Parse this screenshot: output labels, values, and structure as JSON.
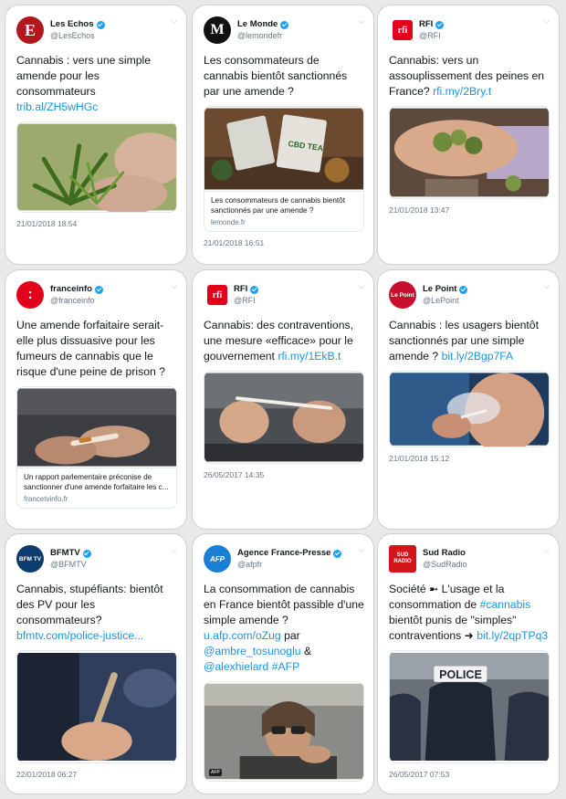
{
  "tweets": [
    {
      "name": "Les Echos",
      "handle": "@LesEchos",
      "avatar_text": "E",
      "avatar_color": "#b3171e",
      "text": "Cannabis : vers une simple amende pour les consommateurs ",
      "link": "trib.al/ZH5wHGc",
      "after": "",
      "timestamp": "21/01/2018 18:54",
      "photo": "cannabis-plant"
    },
    {
      "name": "Le Monde",
      "handle": "@lemondefr",
      "avatar_text": "M",
      "avatar_color": "#111111",
      "text": "Les consommateurs de cannabis bientôt sanctionnés par une amende ?",
      "link": "",
      "after": "",
      "card_title": "Les consommateurs de cannabis bientôt sanctionnés par une amende ?",
      "card_source": "lemonde.fr",
      "timestamp": "21/01/2018 16:51",
      "photo": "cbd-tea-bags"
    },
    {
      "name": "RFI",
      "handle": "@RFI",
      "avatar_text": "rfi",
      "avatar_color": "#e2001a",
      "text": "Cannabis: vers un assouplissement des peines en France? ",
      "link": "rfi.my/2Bry.t",
      "after": "",
      "timestamp": "21/01/2018 13:47",
      "photo": "hand-cannabis-buds"
    },
    {
      "name": "franceinfo",
      "handle": "@franceinfo",
      "avatar_text": ":",
      "avatar_color": "#e2001a",
      "text": "Une amende forfaitaire serait-elle plus dissuasive pour les fumeurs de cannabis que le risque d'une peine de prison ?",
      "link": "",
      "after": "",
      "card_title": "Un rapport parlementaire préconise de sanctionner d'une amende forfaitaire les c...",
      "card_source": "francetvinfo.fr",
      "timestamp": "",
      "photo": "rolling-joint"
    },
    {
      "name": "RFI",
      "handle": "@RFI",
      "avatar_text": "rfi",
      "avatar_color": "#e2001a",
      "text": "Cannabis: des contraventions, une mesure «efficace» pour le gouvernement ",
      "link": "rfi.my/1EkB.t",
      "after": "",
      "timestamp": "26/05/2017 14:35",
      "photo": "hands-joint"
    },
    {
      "name": "Le Point",
      "handle": "@LePoint",
      "avatar_text": "Le Point",
      "avatar_color": "#c8102e",
      "text": "Cannabis : les usagers bientôt sanctionnés par une simple amende ? ",
      "link": "bit.ly/2Bgp7FA",
      "after": "",
      "timestamp": "21/01/2018 15:12",
      "photo": "smoking-person"
    },
    {
      "name": "BFMTV",
      "handle": "@BFMTV",
      "avatar_text": "BFM TV",
      "avatar_color": "#0c3c6e",
      "text": "Cannabis, stupéfiants: bientôt des PV pour les consommateurs? ",
      "link": "bfmtv.com/police-justice...",
      "after": "",
      "timestamp": "22/01/2018 06:27",
      "photo": "joint-fingers"
    },
    {
      "name": "Agence France-Presse",
      "handle": "@afpfr",
      "avatar_text": "AFP",
      "avatar_color": "#1b7fd8",
      "text": "La consommation de cannabis en France bientôt passible d'une simple amende ? ",
      "link": "u.afp.com/oZug",
      "after": " par ",
      "mention1": "@ambre_tosunoglu",
      "mention_sep": " & ",
      "mention2": "@alexhielard",
      "hashtag": "#AFP",
      "timestamp": "",
      "photo": "man-in-car",
      "badge": "AFP"
    },
    {
      "name": "Sud Radio",
      "handle": "@SudRadio",
      "avatar_text": "SUD RADIO",
      "avatar_color": "#d3141b",
      "text": "Société ➼ L'usage et la consommation de ",
      "link": "#cannabis",
      "after": " bientôt punis de \"simples\" contraventions ➜ ",
      "link2": "bit.ly/2qpTPq3",
      "timestamp": "26/05/2017 07:53",
      "photo": "police-officers",
      "photo_text": "POLICE"
    }
  ],
  "colors": {
    "link": "#1b95e0",
    "verified": "#1da1f2",
    "handle": "#657786"
  }
}
